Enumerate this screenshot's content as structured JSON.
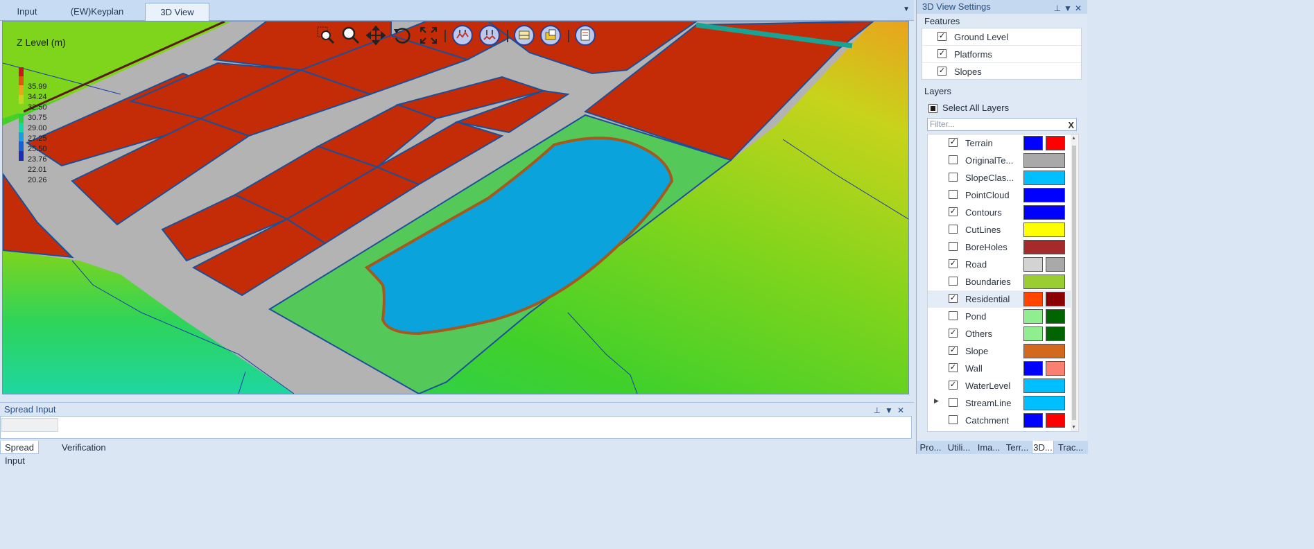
{
  "doc_tabs": [
    {
      "label": "Input",
      "active": false
    },
    {
      "label": "(EW)Keyplan",
      "active": false
    },
    {
      "label": "3D View",
      "active": true
    }
  ],
  "viewport": {
    "legend_title": "Z Level (m)",
    "legend_values": [
      "35.99",
      "34.24",
      "32.50",
      "30.75",
      "29.00",
      "27.25",
      "25.50",
      "23.76",
      "22.01",
      "20.26"
    ],
    "legend_colors": [
      "#c8181a",
      "#e0550f",
      "#e9a31d",
      "#c8d31b",
      "#7fd61c",
      "#2ad23a",
      "#17d6a8",
      "#1a9ee0",
      "#1960d8",
      "#1b2fb4"
    ],
    "toolbar": [
      {
        "icon": "zoom-window-icon"
      },
      {
        "icon": "zoom-icon"
      },
      {
        "icon": "pan-icon"
      },
      {
        "icon": "rotate-icon"
      },
      {
        "icon": "zoom-extents-icon"
      },
      {
        "icon": "exaggerate-up-icon"
      },
      {
        "icon": "exaggerate-down-icon"
      },
      {
        "icon": "section-icon"
      },
      {
        "icon": "profile-icon"
      },
      {
        "icon": "export-icon"
      }
    ]
  },
  "spread_panel": {
    "title": "Spread Input"
  },
  "bottom_tabs": [
    {
      "label": "Spread Input",
      "active": true
    },
    {
      "label": "Verification",
      "active": false
    }
  ],
  "settings_panel": {
    "title": "3D View Settings",
    "features_title": "Features",
    "features": [
      {
        "label": "Ground Level",
        "checked": true
      },
      {
        "label": "Platforms",
        "checked": true
      },
      {
        "label": "Slopes",
        "checked": true
      }
    ],
    "layers_title": "Layers",
    "select_all_label": "Select All Layers",
    "filter_placeholder": "Filter...",
    "filter_clear": "X",
    "layers": [
      {
        "name": "Terrain",
        "checked": true,
        "colors": [
          "#0000ff",
          "#ff0000"
        ]
      },
      {
        "name": "OriginalTe...",
        "checked": false,
        "colors": [
          "#a9a9a9"
        ]
      },
      {
        "name": "SlopeClas...",
        "checked": false,
        "colors": [
          "#00bfff"
        ]
      },
      {
        "name": "PointCloud",
        "checked": false,
        "colors": [
          "#0000ff"
        ]
      },
      {
        "name": "Contours",
        "checked": true,
        "colors": [
          "#0000ff"
        ]
      },
      {
        "name": "CutLines",
        "checked": false,
        "colors": [
          "#ffff00"
        ]
      },
      {
        "name": "BoreHoles",
        "checked": false,
        "colors": [
          "#a52a2a"
        ]
      },
      {
        "name": "Road",
        "checked": true,
        "colors": [
          "#d3d3d3",
          "#a9a9a9"
        ]
      },
      {
        "name": "Boundaries",
        "checked": false,
        "colors": [
          "#9acd32"
        ]
      },
      {
        "name": "Residential",
        "checked": true,
        "colors": [
          "#ff4500",
          "#8b0000"
        ],
        "selected": true
      },
      {
        "name": "Pond",
        "checked": false,
        "colors": [
          "#90ee90",
          "#006400"
        ]
      },
      {
        "name": "Others",
        "checked": true,
        "colors": [
          "#90ee90",
          "#006400"
        ]
      },
      {
        "name": "Slope",
        "checked": true,
        "colors": [
          "#d2691e"
        ]
      },
      {
        "name": "Wall",
        "checked": true,
        "colors": [
          "#0000ff",
          "#fa8072"
        ]
      },
      {
        "name": "WaterLevel",
        "checked": true,
        "colors": [
          "#00bfff"
        ]
      },
      {
        "name": "StreamLine",
        "checked": false,
        "colors": [
          "#00bfff"
        ],
        "expandable": true
      },
      {
        "name": "Catchment",
        "checked": false,
        "colors": [
          "#0000ff",
          "#ff0000"
        ]
      }
    ],
    "tabs": [
      {
        "label": "Pro...",
        "active": false
      },
      {
        "label": "Utili...",
        "active": false
      },
      {
        "label": "Ima...",
        "active": false
      },
      {
        "label": "Terr...",
        "active": false
      },
      {
        "label": "3D...",
        "active": true
      },
      {
        "label": "Trac...",
        "active": false
      }
    ]
  }
}
